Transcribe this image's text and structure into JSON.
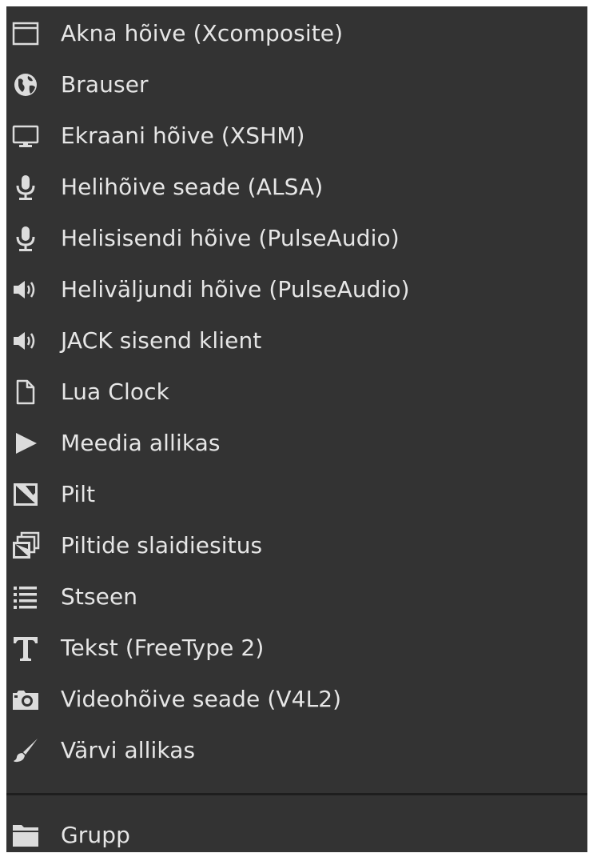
{
  "menu": {
    "items": [
      {
        "label": "Akna hõive (Xcomposite)",
        "icon": "window-icon"
      },
      {
        "label": "Brauser",
        "icon": "globe-icon"
      },
      {
        "label": "Ekraani hõive (XSHM)",
        "icon": "monitor-icon"
      },
      {
        "label": "Helihõive seade (ALSA)",
        "icon": "microphone-icon"
      },
      {
        "label": "Helisisendi hõive (PulseAudio)",
        "icon": "microphone-icon"
      },
      {
        "label": "Heliväljundi hõive (PulseAudio)",
        "icon": "speaker-icon"
      },
      {
        "label": "JACK sisend klient",
        "icon": "speaker-icon"
      },
      {
        "label": "Lua Clock",
        "icon": "file-icon"
      },
      {
        "label": "Meedia allikas",
        "icon": "play-icon"
      },
      {
        "label": "Pilt",
        "icon": "image-icon"
      },
      {
        "label": "Piltide slaidiesitus",
        "icon": "slideshow-icon"
      },
      {
        "label": "Stseen",
        "icon": "list-icon"
      },
      {
        "label": "Tekst (FreeType 2)",
        "icon": "text-icon"
      },
      {
        "label": "Videohõive seade (V4L2)",
        "icon": "camera-icon"
      },
      {
        "label": "Värvi allikas",
        "icon": "brush-icon"
      }
    ],
    "group_item": {
      "label": "Grupp",
      "icon": "folder-icon"
    }
  },
  "colors": {
    "background": "#333333",
    "text": "#e6e6e6",
    "icon": "#dcdcdc",
    "separator": "#1e1e1e"
  }
}
